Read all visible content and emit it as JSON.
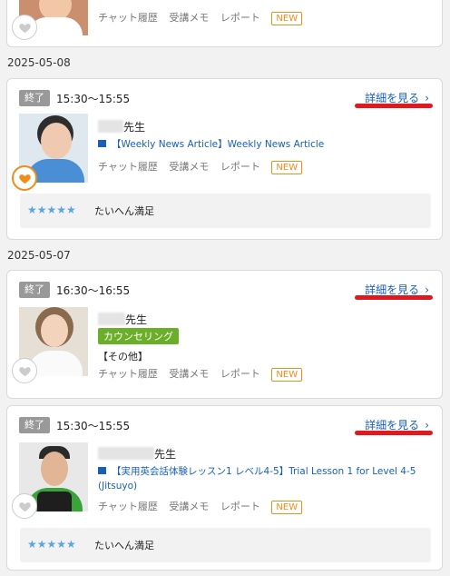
{
  "top_card": {
    "meta": [
      "チャット履歴",
      "受講メモ",
      "レポート"
    ],
    "new_label": "NEW"
  },
  "groups": [
    {
      "date": "2025-05-08",
      "status": "終了",
      "time": "15:30〜15:55",
      "detail_label": "詳細を見る",
      "teacher_suffix": "先生",
      "lesson_title": "【Weekly News Article】Weekly News Article",
      "meta": [
        "チャット履歴",
        "受講メモ",
        "レポート"
      ],
      "new_label": "NEW",
      "review_text": "たいへん満足",
      "stars": "★★★★★"
    },
    {
      "date": "2025-05-07",
      "status": "終了",
      "time": "16:30〜16:55",
      "detail_label": "詳細を見る",
      "teacher_suffix": "先生",
      "tag": "カウンセリング",
      "other": "【その他】",
      "meta": [
        "チャット履歴",
        "受講メモ",
        "レポート"
      ],
      "new_label": "NEW"
    },
    {
      "status": "終了",
      "time": "15:30〜15:55",
      "detail_label": "詳細を見る",
      "teacher_suffix": "先生",
      "lesson_title_line1": "【実用英会話体験レッスン1 レベル4-5】Trial Lesson 1 for Level 4-5",
      "lesson_title_line2": "(Jitsuyo)",
      "meta": [
        "チャット履歴",
        "受講メモ",
        "レポート"
      ],
      "new_label": "NEW",
      "review_text": "たいへん満足",
      "stars": "★★★★★"
    }
  ],
  "colors": {
    "accent_link": "#1a5fb4",
    "highlight_underline": "#e0191e",
    "new_badge": "#f08c19",
    "counsel_tag": "#6aae2a",
    "stars": "#5aa7e0"
  }
}
